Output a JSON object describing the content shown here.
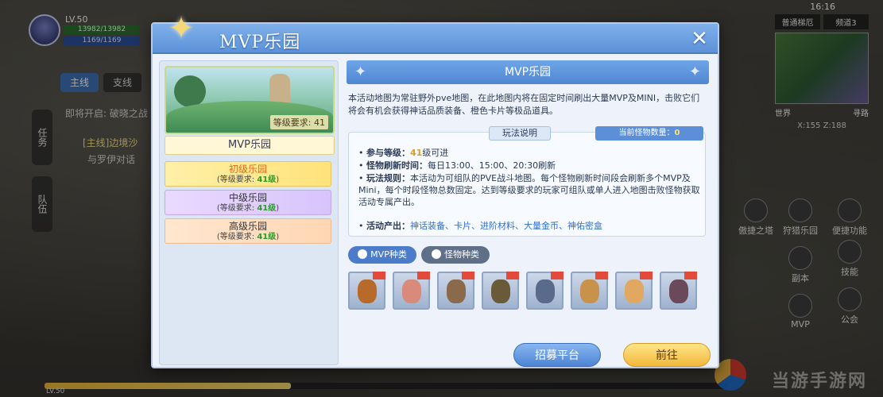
{
  "hud": {
    "level": "LV.50",
    "hp": "13982/13982",
    "mp": "1169/1169",
    "time": "16:16",
    "exp_fraction": 0.36,
    "exp_level_small": "LV.50"
  },
  "quest": {
    "tab_main": "主线",
    "tab_branch": "支线",
    "coming": "即将开启: 破晓之战",
    "main_quest": "[主线]边境沙",
    "sub_quest": "与罗伊对话",
    "side_tab_task": "任务",
    "side_tab_team": "队伍"
  },
  "minimap": {
    "tab_1": "普通梯厄",
    "tab_2": "频道3",
    "world": "世界",
    "seek": "寻路",
    "coords": "X:155  Z:188"
  },
  "right_menu": [
    {
      "name": "menu-item-1",
      "label": "傲捷之塔"
    },
    {
      "name": "menu-item-2",
      "label": "狩猎乐园"
    },
    {
      "name": "menu-item-3",
      "label": "便捷功能"
    },
    {
      "name": "menu-item-4",
      "label": "副本"
    },
    {
      "name": "menu-item-5",
      "label": "技能"
    },
    {
      "name": "menu-item-6",
      "label": "MVP"
    },
    {
      "name": "menu-item-7",
      "label": "公会"
    }
  ],
  "watermark": "当游手游网",
  "dialog": {
    "title": "MVP乐园",
    "close": "✕"
  },
  "left": {
    "featured_req": "等级要求: 41",
    "featured_label": "MVP乐园",
    "parks": [
      {
        "name": "初级乐园",
        "req_prefix": "(等级要求: ",
        "req_level": "41级",
        "req_suffix": ")"
      },
      {
        "name": "中级乐园",
        "req_prefix": "(等级要求: ",
        "req_level": "41级",
        "req_suffix": ")"
      },
      {
        "name": "高级乐园",
        "req_prefix": "(等级要求: ",
        "req_level": "41级",
        "req_suffix": ")"
      }
    ]
  },
  "right": {
    "header": "MVP乐园",
    "description": "本活动地图为常驻野外pve地图，在此地图内将在固定时间刷出大量MVP及MINI，击败它们将会有机会获得神话品质装备、橙色卡片等极品道具。",
    "rules_tag": "玩法说明",
    "monster_count_label": "当前怪物数量：",
    "monster_count_value": "0",
    "rules": {
      "level_key": "参与等级：",
      "level_value": "41",
      "level_suffix": "级可进",
      "refresh_key": "怪物刷新时间：",
      "refresh_value": "每日13:00、15:00、20:30刷新",
      "play_key": "玩法规则：",
      "play_value": "本活动为可组队的PVE战斗地图。每个怪物刷新时间段会刷新多个MVP及Mini，每个时段怪物总数固定。达到等级要求的玩家可组队或单人进入地图击败怪物获取活动专属产出。",
      "output_key": "活动产出：",
      "output_value": "神话装备、卡片、进阶材料、大量金币、神佑密盒"
    },
    "tab_mvp": "MVP种类",
    "tab_monster": "怪物种类",
    "monsters": [
      {
        "name": "monster-1",
        "color": "#b86a2a"
      },
      {
        "name": "monster-2",
        "color": "#d98a7a"
      },
      {
        "name": "monster-3",
        "color": "#8a6a4a"
      },
      {
        "name": "monster-4",
        "color": "#6a5a3a"
      },
      {
        "name": "monster-5",
        "color": "#5a6a8a"
      },
      {
        "name": "monster-6",
        "color": "#c8924a"
      },
      {
        "name": "monster-7",
        "color": "#e0a860"
      },
      {
        "name": "monster-8",
        "color": "#6a4a5a"
      }
    ],
    "btn_recruit": "招募平台",
    "btn_go": "前往"
  }
}
